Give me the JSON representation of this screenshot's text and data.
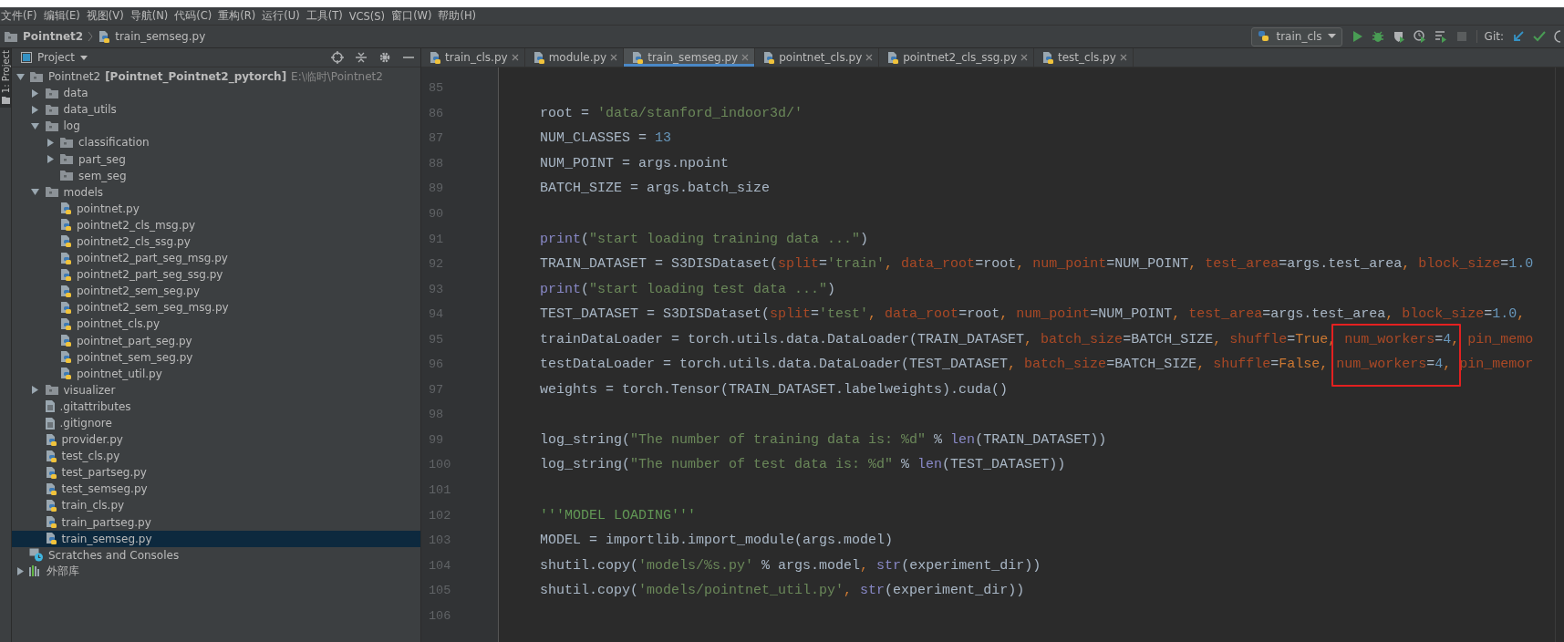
{
  "menu": [
    "文件(F)",
    "编辑(E)",
    "视图(V)",
    "导航(N)",
    "代码(C)",
    "重构(R)",
    "运行(U)",
    "工具(T)",
    "VCS(S)",
    "窗口(W)",
    "帮助(H)"
  ],
  "breadcrumbs": [
    {
      "kind": "folder",
      "label": "Pointnet2"
    },
    {
      "kind": "python",
      "label": "train_semseg.py"
    }
  ],
  "run_toolbar": {
    "config": "train_cls",
    "git_label": "Git:"
  },
  "tool_strip": {
    "label": "1: Project"
  },
  "project_panel": {
    "title": "Project",
    "tree": [
      {
        "kind": "folder",
        "label": "Pointnet2",
        "module": "[Pointnet_Pointnet2_pytorch]",
        "path": "E:\\临时\\Pointnet2",
        "expanded": true,
        "selected": false,
        "children": [
          {
            "kind": "folder",
            "label": "data",
            "expanded": false,
            "selected": false
          },
          {
            "kind": "folder",
            "label": "data_utils",
            "expanded": false,
            "selected": false
          },
          {
            "kind": "folder",
            "label": "log",
            "expanded": true,
            "selected": false,
            "children": [
              {
                "kind": "folder",
                "label": "classification",
                "expanded": false,
                "selected": false
              },
              {
                "kind": "folder",
                "label": "part_seg",
                "expanded": false,
                "selected": false
              },
              {
                "kind": "folder",
                "label": "sem_seg",
                "selected": false
              }
            ]
          },
          {
            "kind": "folder",
            "label": "models",
            "expanded": true,
            "selected": false,
            "children": [
              {
                "kind": "python",
                "label": "pointnet.py",
                "selected": false
              },
              {
                "kind": "python",
                "label": "pointnet2_cls_msg.py",
                "selected": false
              },
              {
                "kind": "python",
                "label": "pointnet2_cls_ssg.py",
                "selected": false
              },
              {
                "kind": "python",
                "label": "pointnet2_part_seg_msg.py",
                "selected": false
              },
              {
                "kind": "python",
                "label": "pointnet2_part_seg_ssg.py",
                "selected": false
              },
              {
                "kind": "python",
                "label": "pointnet2_sem_seg.py",
                "selected": false
              },
              {
                "kind": "python",
                "label": "pointnet2_sem_seg_msg.py",
                "selected": false
              },
              {
                "kind": "python",
                "label": "pointnet_cls.py",
                "selected": false
              },
              {
                "kind": "python",
                "label": "pointnet_part_seg.py",
                "selected": false
              },
              {
                "kind": "python",
                "label": "pointnet_sem_seg.py",
                "selected": false
              },
              {
                "kind": "python",
                "label": "pointnet_util.py",
                "selected": false
              }
            ]
          },
          {
            "kind": "folder",
            "label": "visualizer",
            "expanded": false,
            "selected": false
          },
          {
            "kind": "text",
            "label": ".gitattributes",
            "selected": false
          },
          {
            "kind": "text",
            "label": ".gitignore",
            "selected": false
          },
          {
            "kind": "python",
            "label": "provider.py",
            "selected": false
          },
          {
            "kind": "python",
            "label": "test_cls.py",
            "selected": false
          },
          {
            "kind": "python",
            "label": "test_partseg.py",
            "selected": false
          },
          {
            "kind": "python",
            "label": "test_semseg.py",
            "selected": false
          },
          {
            "kind": "python",
            "label": "train_cls.py",
            "selected": false
          },
          {
            "kind": "python",
            "label": "train_partseg.py",
            "selected": false
          },
          {
            "kind": "python",
            "label": "train_semseg.py",
            "selected": true
          }
        ]
      },
      {
        "kind": "scratches",
        "label": "Scratches and Consoles",
        "selected": false
      },
      {
        "kind": "library",
        "label": "外部库",
        "expanded": false,
        "selected": false
      }
    ]
  },
  "tabs": [
    {
      "label": "train_cls.py",
      "selected": false
    },
    {
      "label": "module.py",
      "selected": false
    },
    {
      "label": "train_semseg.py",
      "selected": true
    },
    {
      "label": "pointnet_cls.py",
      "selected": false
    },
    {
      "label": "pointnet2_cls_ssg.py",
      "selected": false
    },
    {
      "label": "test_cls.py",
      "selected": false
    }
  ],
  "code": [
    {
      "number": "85"
    },
    {
      "number": "86",
      "segments": [
        {
          "kind": "plain",
          "text": "root = "
        },
        {
          "kind": "string",
          "text": "'data/stanford_indoor3d/'"
        }
      ]
    },
    {
      "number": "87",
      "segments": [
        {
          "kind": "plain",
          "text": "NUM_CLASSES = "
        },
        {
          "kind": "number",
          "text": "13"
        }
      ]
    },
    {
      "number": "88",
      "segments": [
        {
          "kind": "plain",
          "text": "NUM_POINT = args.npoint"
        }
      ]
    },
    {
      "number": "89",
      "segments": [
        {
          "kind": "plain",
          "text": "BATCH_SIZE = args.batch_size"
        }
      ]
    },
    {
      "number": "90"
    },
    {
      "number": "91",
      "segments": [
        {
          "kind": "builtin",
          "text": "print"
        },
        {
          "kind": "plain",
          "text": "("
        },
        {
          "kind": "string",
          "text": "\"start loading training data ...\""
        },
        {
          "kind": "plain",
          "text": ")"
        }
      ]
    },
    {
      "number": "92",
      "segments": [
        {
          "kind": "plain",
          "text": "TRAIN_DATASET = S3DISDataset("
        },
        {
          "kind": "kwarg",
          "text": "split"
        },
        {
          "kind": "plain",
          "text": "="
        },
        {
          "kind": "string",
          "text": "'train'"
        },
        {
          "kind": "keyword",
          "text": ", "
        },
        {
          "kind": "kwarg",
          "text": "data_root"
        },
        {
          "kind": "plain",
          "text": "=root"
        },
        {
          "kind": "keyword",
          "text": ", "
        },
        {
          "kind": "kwarg",
          "text": "num_point"
        },
        {
          "kind": "plain",
          "text": "=NUM_POINT"
        },
        {
          "kind": "keyword",
          "text": ", "
        },
        {
          "kind": "kwarg",
          "text": "test_area"
        },
        {
          "kind": "plain",
          "text": "=args.test_area"
        },
        {
          "kind": "keyword",
          "text": ", "
        },
        {
          "kind": "kwarg",
          "text": "block_size"
        },
        {
          "kind": "plain",
          "text": "="
        },
        {
          "kind": "number",
          "text": "1.0"
        }
      ]
    },
    {
      "number": "93",
      "segments": [
        {
          "kind": "builtin",
          "text": "print"
        },
        {
          "kind": "plain",
          "text": "("
        },
        {
          "kind": "string",
          "text": "\"start loading test data ...\""
        },
        {
          "kind": "plain",
          "text": ")"
        }
      ]
    },
    {
      "number": "94",
      "segments": [
        {
          "kind": "plain",
          "text": "TEST_DATASET = S3DISDataset("
        },
        {
          "kind": "kwarg",
          "text": "split"
        },
        {
          "kind": "plain",
          "text": "="
        },
        {
          "kind": "string",
          "text": "'test'"
        },
        {
          "kind": "keyword",
          "text": ", "
        },
        {
          "kind": "kwarg",
          "text": "data_root"
        },
        {
          "kind": "plain",
          "text": "=root"
        },
        {
          "kind": "keyword",
          "text": ", "
        },
        {
          "kind": "kwarg",
          "text": "num_point"
        },
        {
          "kind": "plain",
          "text": "=NUM_POINT"
        },
        {
          "kind": "keyword",
          "text": ", "
        },
        {
          "kind": "kwarg",
          "text": "test_area"
        },
        {
          "kind": "plain",
          "text": "=args.test_area"
        },
        {
          "kind": "keyword",
          "text": ", "
        },
        {
          "kind": "kwarg",
          "text": "block_size"
        },
        {
          "kind": "plain",
          "text": "="
        },
        {
          "kind": "number",
          "text": "1.0"
        },
        {
          "kind": "keyword",
          "text": ","
        }
      ]
    },
    {
      "number": "95",
      "segments": [
        {
          "kind": "plain",
          "text": "trainDataLoader = torch.utils.data.DataLoader(TRAIN_DATASET"
        },
        {
          "kind": "keyword",
          "text": ", "
        },
        {
          "kind": "kwarg",
          "text": "batch_size"
        },
        {
          "kind": "plain",
          "text": "=BATCH_SIZE"
        },
        {
          "kind": "keyword",
          "text": ", "
        },
        {
          "kind": "kwarg",
          "text": "shuffle"
        },
        {
          "kind": "plain",
          "text": "="
        },
        {
          "kind": "keyword",
          "text": "True"
        },
        {
          "kind": "keyword",
          "text": ", "
        },
        {
          "kind": "kwarg",
          "text": "num_workers",
          "boxed": true
        },
        {
          "kind": "plain",
          "text": "=",
          "boxed": true
        },
        {
          "kind": "number",
          "text": "4",
          "boxed": true
        },
        {
          "kind": "keyword",
          "text": ", "
        },
        {
          "kind": "kwarg",
          "text": "pin_memo"
        }
      ]
    },
    {
      "number": "96",
      "segments": [
        {
          "kind": "plain",
          "text": "testDataLoader = torch.utils.data.DataLoader(TEST_DATASET"
        },
        {
          "kind": "keyword",
          "text": ", "
        },
        {
          "kind": "kwarg",
          "text": "batch_size"
        },
        {
          "kind": "plain",
          "text": "=BATCH_SIZE"
        },
        {
          "kind": "keyword",
          "text": ", "
        },
        {
          "kind": "kwarg",
          "text": "shuffle"
        },
        {
          "kind": "plain",
          "text": "="
        },
        {
          "kind": "keyword",
          "text": "False"
        },
        {
          "kind": "keyword",
          "text": ", "
        },
        {
          "kind": "kwarg",
          "text": "num_workers",
          "boxed": true
        },
        {
          "kind": "plain",
          "text": "=",
          "boxed": true
        },
        {
          "kind": "number",
          "text": "4",
          "boxed": true
        },
        {
          "kind": "keyword",
          "text": ", "
        },
        {
          "kind": "kwarg",
          "text": "pin_memor"
        }
      ]
    },
    {
      "number": "97",
      "segments": [
        {
          "kind": "plain",
          "text": "weights = torch.Tensor(TRAIN_DATASET.labelweights).cuda()"
        }
      ]
    },
    {
      "number": "98"
    },
    {
      "number": "99",
      "segments": [
        {
          "kind": "plain",
          "text": "log_string("
        },
        {
          "kind": "string",
          "text": "\"The number of training data is: %d\""
        },
        {
          "kind": "plain",
          "text": " % "
        },
        {
          "kind": "builtin",
          "text": "len"
        },
        {
          "kind": "plain",
          "text": "(TRAIN_DATASET))"
        }
      ]
    },
    {
      "number": "100",
      "segments": [
        {
          "kind": "plain",
          "text": "log_string("
        },
        {
          "kind": "string",
          "text": "\"The number of test data is: %d\""
        },
        {
          "kind": "plain",
          "text": " % "
        },
        {
          "kind": "builtin",
          "text": "len"
        },
        {
          "kind": "plain",
          "text": "(TEST_DATASET))"
        }
      ]
    },
    {
      "number": "101"
    },
    {
      "number": "102",
      "segments": [
        {
          "kind": "docstring",
          "text": "'''MODEL LOADING'''"
        }
      ]
    },
    {
      "number": "103",
      "segments": [
        {
          "kind": "plain",
          "text": "MODEL = importlib.import_module(args.model)"
        }
      ]
    },
    {
      "number": "104",
      "segments": [
        {
          "kind": "plain",
          "text": "shutil.copy("
        },
        {
          "kind": "string",
          "text": "'models/%s.py'"
        },
        {
          "kind": "plain",
          "text": " % args.model"
        },
        {
          "kind": "keyword",
          "text": ", "
        },
        {
          "kind": "builtin",
          "text": "str"
        },
        {
          "kind": "plain",
          "text": "(experiment_dir))"
        }
      ]
    },
    {
      "number": "105",
      "segments": [
        {
          "kind": "plain",
          "text": "shutil.copy("
        },
        {
          "kind": "string",
          "text": "'models/pointnet_util.py'"
        },
        {
          "kind": "keyword",
          "text": ", "
        },
        {
          "kind": "builtin",
          "text": "str"
        },
        {
          "kind": "plain",
          "text": "(experiment_dir))"
        }
      ]
    },
    {
      "number": "106"
    }
  ]
}
